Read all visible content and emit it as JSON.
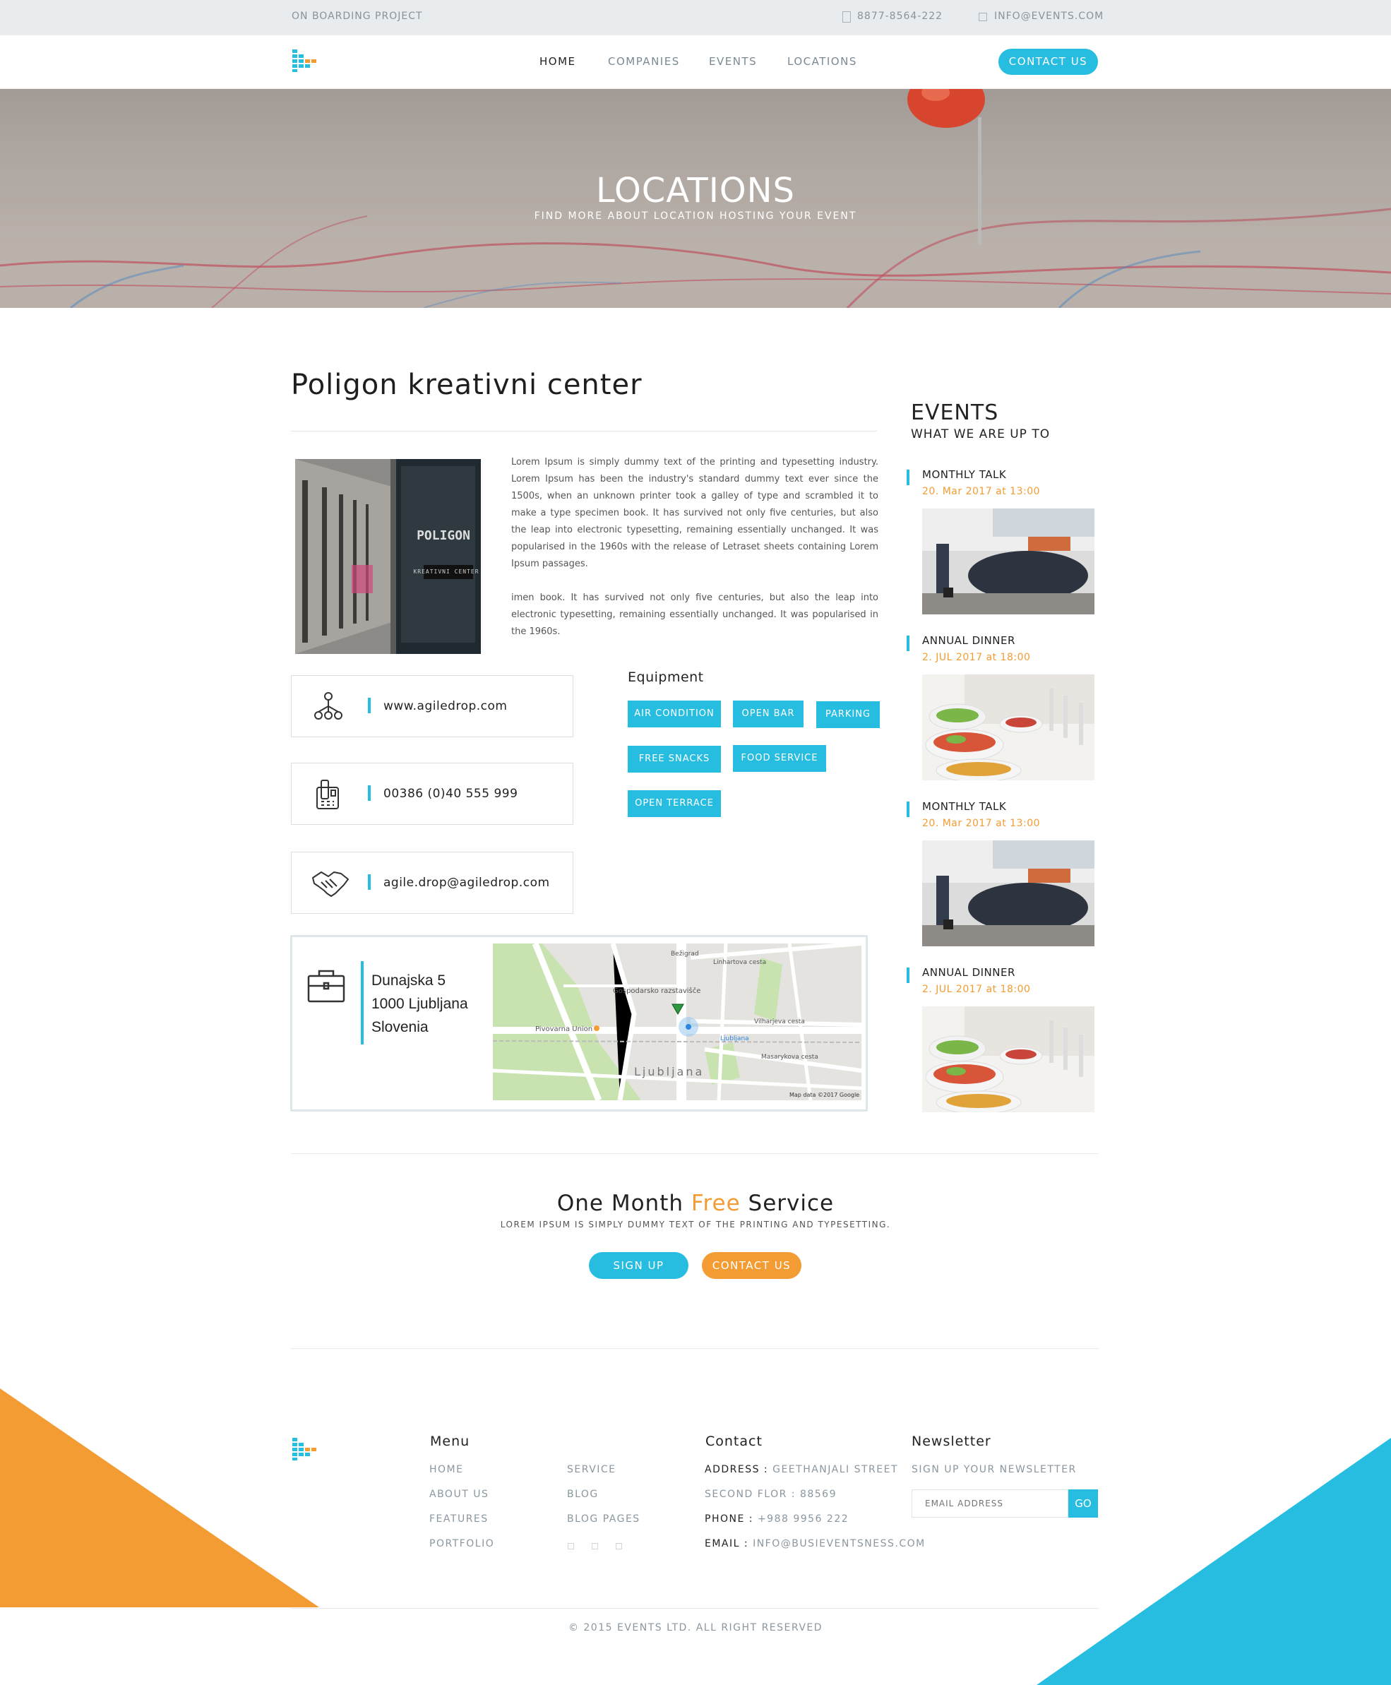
{
  "topbar": {
    "project": "ON BOARDING PROJECT",
    "phone": "8877-8564-222",
    "email": "INFO@EVENTS.COM"
  },
  "nav": {
    "items": [
      "HOME",
      "COMPANIES",
      "EVENTS",
      "LOCATIONS"
    ],
    "contact": "CONTACT US"
  },
  "hero": {
    "title": "LOCATIONS",
    "subtitle": "FIND MORE ABOUT LOCATION HOSTING YOUR EVENT"
  },
  "location": {
    "name": "Poligon kreativni center",
    "image_sign": "POLIGON",
    "image_sub": "KREATIVNI CENTER",
    "paragraph1": "Lorem Ipsum is simply dummy text of the printing and typesetting industry. Lorem Ipsum has been the industry's standard dummy text ever since the 1500s, when an unknown printer took a galley of type and scrambled it to make a type specimen book. It has survived not only five centuries, but also the leap into electronic typesetting, remaining essentially unchanged. It was popularised in the 1960s with the release of Letraset sheets containing Lorem Ipsum passages.",
    "paragraph2": "imen book. It has survived not only five centuries, but also the leap into electronic typesetting, remaining essentially unchanged. It was popularised in the 1960s.",
    "website": "www.agiledrop.com",
    "phone": "00386 (0)40 555 999",
    "email": "agile.drop@agiledrop.com",
    "address": {
      "line1": "Dunajska 5",
      "line2": "1000 Ljubljana",
      "line3": "Slovenia"
    },
    "equipment_title": "Equipment",
    "equipment": [
      "AIR CONDITION",
      "OPEN BAR",
      "PARKING",
      "FREE SNACKS",
      "FOOD SERVICE",
      "OPEN TERRACE"
    ]
  },
  "map": {
    "labels": [
      "Bežigrad",
      "Linhartova cesta",
      "Gospodarsko razstavišče",
      "Pivovarna Union",
      "Vilharjeva cesta",
      "Ljubljana",
      "Masarykova cesta",
      "Ljubljana"
    ],
    "credit": "Map data ©2017 Google"
  },
  "sidebar": {
    "title": "EVENTS",
    "subtitle": "WHAT WE ARE UP TO",
    "events": [
      {
        "title": "MONTHLY TALK",
        "date": "20. Mar 2017 at 13:00",
        "kind": "talk"
      },
      {
        "title": "ANNUAL DINNER",
        "date": "2. JUL 2017 at 18:00",
        "kind": "dinner"
      },
      {
        "title": "MONTHLY TALK",
        "date": "20. Mar 2017 at 13:00",
        "kind": "talk"
      },
      {
        "title": "ANNUAL DINNER",
        "date": "2. JUL 2017 at 18:00",
        "kind": "dinner"
      }
    ]
  },
  "promo": {
    "title_pre": "One Month ",
    "title_highlight": "Free",
    "title_post": " Service",
    "subtitle": "LOREM IPSUM IS SIMPLY DUMMY TEXT OF THE PRINTING AND TYPESETTING.",
    "signup": "SIGN UP",
    "contact": "CONTACT US"
  },
  "footer": {
    "menu_title": "Menu",
    "menu_col1": [
      "HOME",
      "ABOUT US",
      "FEATURES",
      "PORTFOLIO"
    ],
    "menu_col2": [
      "SERVICE",
      "BLOG",
      "BLOG PAGES"
    ],
    "contact_title": "Contact",
    "address_label": "ADDRESS :",
    "address_value": "GEETHANJALI STREET",
    "address_value2": "SECOND FLOR : 88569",
    "phone_label": "PHONE :",
    "phone_value": "+988 9956 222",
    "email_label": "EMAIL :",
    "email_value": "INFO@BUSIEVENTSNESS.COM",
    "newsletter_title": "Newsletter",
    "newsletter_sub": "SIGN UP YOUR NEWSLETTER",
    "newsletter_placeholder": "EMAIL ADDRESS",
    "newsletter_button": "GO",
    "copyright": "© 2015 EVENTS LTD. ALL RIGHT RESERVED"
  },
  "colors": {
    "accent": "#27bde0",
    "orange": "#f39c33",
    "topbar": "#e8ecee"
  }
}
